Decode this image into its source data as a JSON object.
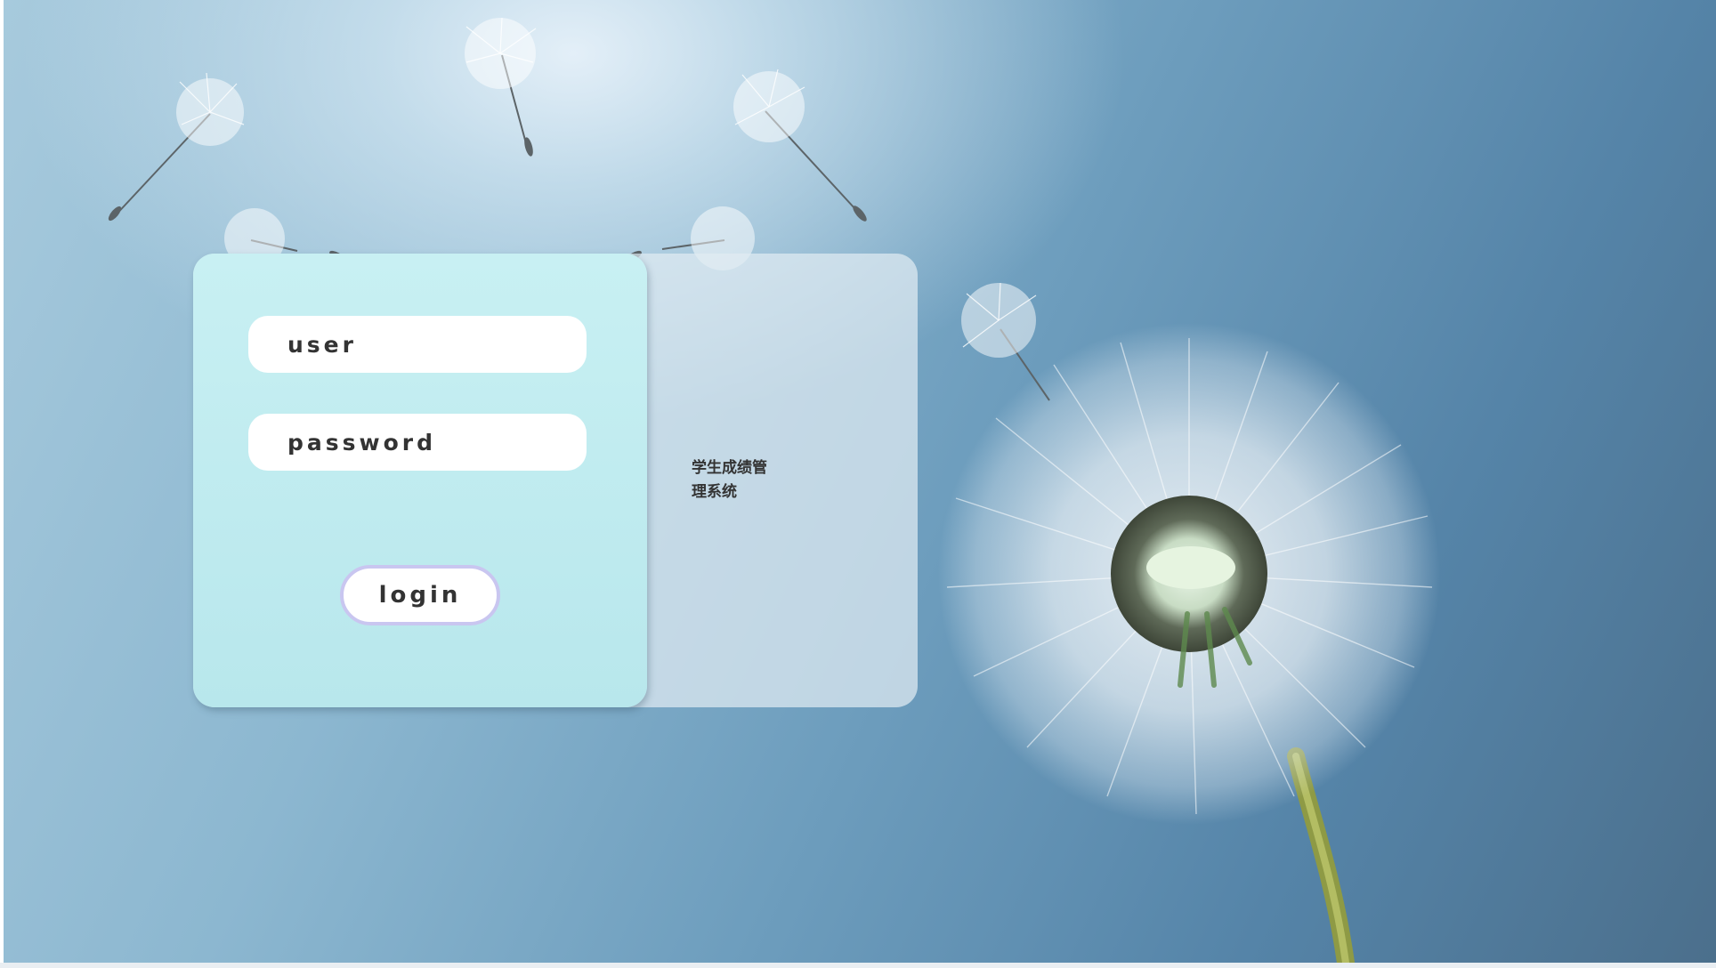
{
  "login_form": {
    "user_placeholder": "user",
    "password_placeholder": "password",
    "login_label": "login"
  },
  "side_panel": {
    "title": "学生成绩管理系统"
  },
  "background": {
    "subject": "dandelion-icon",
    "colors": {
      "sky_light": "#dcebf5",
      "sky_dark": "#4b6f8c",
      "form_panel": "#c8f0f3",
      "button_border": "#c9c6f0"
    }
  }
}
